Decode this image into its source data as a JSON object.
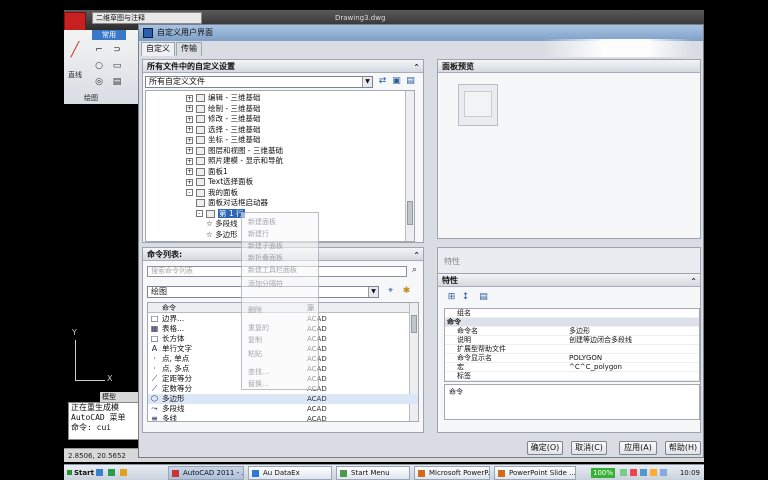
{
  "acad": {
    "title": "Drawing3.dwg",
    "workspace": "二维草图与注释",
    "ribbon_tab": "常用",
    "ribbon_label": "直线",
    "panel_label": "绘图",
    "model_tab": "模型",
    "axis_x": "X",
    "axis_y": "Y",
    "cmd_history": [
      "正在重生成模",
      "AutoCAD 菜单",
      "命令: cui"
    ],
    "status_coords": "2.8506, 20.5652"
  },
  "dialog": {
    "title": "自定义用户界面",
    "tabs": [
      "自定义",
      "传输"
    ],
    "all_files_panel": {
      "header": "所有文件中的自定义设置",
      "combo_value": "所有自定义文件",
      "tree": [
        {
          "label": "编辑 - 三维基础",
          "level": 0,
          "expander": "+"
        },
        {
          "label": "绘制 - 三维基础",
          "level": 0,
          "expander": "+"
        },
        {
          "label": "修改 - 三维基础",
          "level": 0,
          "expander": "+"
        },
        {
          "label": "选择 - 三维基础",
          "level": 0,
          "expander": "+"
        },
        {
          "label": "坐标 - 三维基础",
          "level": 0,
          "expander": "+"
        },
        {
          "label": "图层和视图 - 三维基础",
          "level": 0,
          "expander": "+"
        },
        {
          "label": "照片建模 - 显示和导航",
          "level": 0,
          "expander": "+"
        },
        {
          "label": "面板1",
          "level": 0,
          "expander": "+"
        },
        {
          "label": "Text选择面板",
          "level": 0,
          "expander": "+"
        },
        {
          "label": "我的面板",
          "level": 0,
          "expander": "-"
        },
        {
          "label": "面板对话框启动器",
          "level": 1,
          "expander": ""
        },
        {
          "label": "第 1 行",
          "level": 1,
          "expander": "-",
          "selected": true
        },
        {
          "label": "多段线",
          "level": 2,
          "expander": "",
          "star": true
        },
        {
          "label": "多边形",
          "level": 2,
          "expander": "",
          "star": true
        }
      ]
    },
    "context_menu": {
      "items": [
        "新建面板",
        "新建行",
        "新建子面板",
        "新折叠面板",
        "新建工具栏面板",
        "添加分隔符",
        "删除",
        "重复的",
        "复制",
        "粘贴",
        "查找...",
        "替换..."
      ]
    },
    "commands_panel": {
      "header": "命令列表:",
      "search_placeholder": "搜索命令列表",
      "category": "绘图",
      "col_command": "命令",
      "col_source": "源",
      "rows": [
        {
          "icon": "□",
          "name": "边界...",
          "source": "ACAD"
        },
        {
          "icon": "▦",
          "name": "表格...",
          "source": "ACAD"
        },
        {
          "icon": "□",
          "name": "长方体",
          "source": "ACAD"
        },
        {
          "icon": "A",
          "name": "单行文字",
          "source": "ACAD"
        },
        {
          "icon": "·",
          "name": "点, 单点",
          "source": "ACAD"
        },
        {
          "icon": "·",
          "name": "点, 多点",
          "source": "ACAD"
        },
        {
          "icon": "⟋",
          "name": "定距等分",
          "source": "ACAD"
        },
        {
          "icon": "⟋",
          "name": "定数等分",
          "source": "ACAD"
        },
        {
          "icon": "⬡",
          "name": "多边形",
          "source": "ACAD",
          "selected": true
        },
        {
          "icon": "⤳",
          "name": "多段线",
          "source": "ACAD"
        },
        {
          "icon": "≡",
          "name": "多线",
          "source": "ACAD"
        }
      ]
    },
    "preview_panel": {
      "header": "面板预览"
    },
    "properties_panel": {
      "collapsed_header": "特性",
      "header": "特性",
      "rows": [
        {
          "key": "组名",
          "value": "",
          "cat": false
        },
        {
          "key": "命令",
          "value": "",
          "cat": true
        },
        {
          "key": "命令名",
          "value": "多边形",
          "cat": false
        },
        {
          "key": "说明",
          "value": "创建等边闭合多段线",
          "cat": false
        },
        {
          "key": "扩展型帮助文件",
          "value": "",
          "cat": false
        },
        {
          "key": "命令显示名",
          "value": "POLYGON",
          "cat": false
        },
        {
          "key": "宏",
          "value": "^C^C_polygon",
          "cat": false
        },
        {
          "key": "标签",
          "value": "",
          "cat": false
        }
      ],
      "description_title": "命令"
    },
    "buttons": {
      "ok": "确定(O)",
      "cancel": "取消(C)",
      "apply": "应用(A)",
      "help": "帮助(H)"
    }
  },
  "taskbar": {
    "start": "Start",
    "items": [
      {
        "label": "AutoCAD 2011 - ...",
        "kind": "acad",
        "active": true
      },
      {
        "label": "Au DataEx",
        "kind": "ex"
      },
      {
        "label": "Start Menu",
        "kind": "sm"
      },
      {
        "label": "Microsoft PowerP...",
        "kind": "ppt"
      },
      {
        "label": "PowerPoint Slide ...",
        "kind": "ppt"
      }
    ],
    "battery": "100%",
    "clock": "10:09"
  }
}
